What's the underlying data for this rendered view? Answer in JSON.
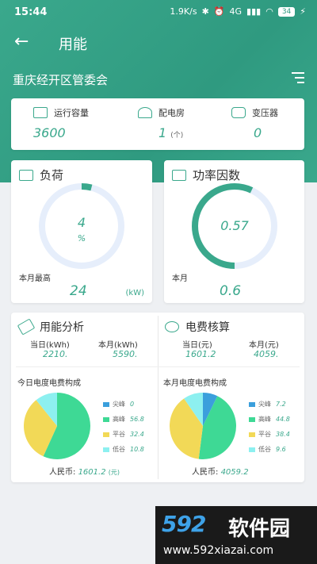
{
  "status": {
    "time": "15:44",
    "speed": "1.9K/s",
    "network": "4G",
    "battery": "34"
  },
  "nav": {
    "title": "用能"
  },
  "org": "重庆经开区管委会",
  "summary": [
    {
      "label": "运行容量",
      "value": "3600",
      "unit": "",
      "icon": "server-icon"
    },
    {
      "label": "配电房",
      "value": "1",
      "unit": "(个)",
      "icon": "house-icon"
    },
    {
      "label": "变压器",
      "value": "0",
      "unit": "",
      "icon": "transformer-icon"
    }
  ],
  "load": {
    "title": "负荷",
    "center_top": "4",
    "center_bottom": "%",
    "percent": 4,
    "sub_label": "本月最高",
    "value": "24",
    "unit": "(kW)"
  },
  "power_factor": {
    "title": "功率因数",
    "center": "0.57",
    "fraction": 0.57,
    "sub_label": "本月",
    "value": "0.6"
  },
  "energy": {
    "title": "用能分析",
    "today_label": "当日(kWh)",
    "today_value": "2210.",
    "month_label": "本月(kWh)",
    "month_value": "5590."
  },
  "cost": {
    "title": "电费核算",
    "today_label": "当日(元)",
    "today_value": "1601.2",
    "month_label": "本月(元)",
    "month_value": "4059."
  },
  "chart_data": [
    {
      "type": "pie",
      "title": "今日电度电费构成",
      "categories": [
        "尖峰",
        "高峰",
        "平谷",
        "低谷"
      ],
      "values": [
        0.0,
        56.8,
        32.4,
        10.8
      ],
      "total_label": "人民币:",
      "total": "1601.2",
      "total_unit": "(元)"
    },
    {
      "type": "pie",
      "title": "本月电度电费构成",
      "categories": [
        "尖峰",
        "高峰",
        "平谷",
        "低谷"
      ],
      "values": [
        7.2,
        44.8,
        38.4,
        9.6
      ],
      "total_label": "人民币:",
      "total": "4059.2",
      "total_unit": ""
    }
  ],
  "colors": {
    "accent": "#3aa88c",
    "peak": "#3b9fdc",
    "high": "#3ed995",
    "flat": "#f2d957",
    "low": "#8df0f0",
    "track": "#e6eefb"
  },
  "watermark": {
    "brand": "592",
    "brand_cn": "软件园",
    "url": "www.592xiazai.com"
  }
}
